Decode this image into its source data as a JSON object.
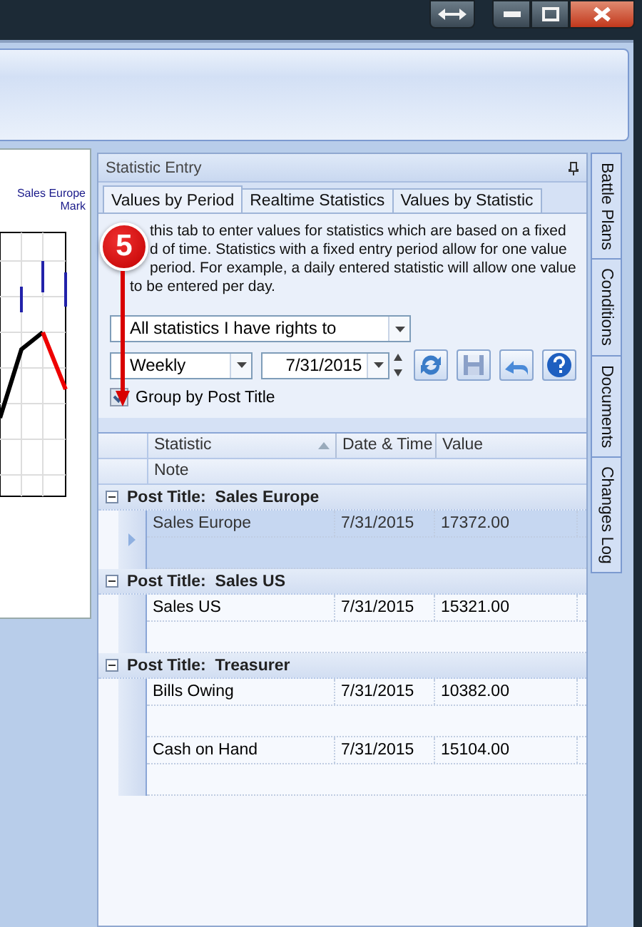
{
  "chart": {
    "legend": [
      "Sales Europe",
      "Mark"
    ]
  },
  "panel": {
    "title": "Statistic Entry",
    "tabs": [
      {
        "label": "Values by Period",
        "selected": true
      },
      {
        "label": "Realtime Statistics",
        "selected": false
      },
      {
        "label": "Values by Statistic",
        "selected": false
      }
    ],
    "description_lines": [
      "this tab to enter values for statistics which are based on a fixed",
      "d of time. Statistics with a fixed entry period allow for one value",
      "period. For example, a daily entered statistic will allow one value",
      "to be entered per day."
    ],
    "statistics_filter": "All statistics I have rights to",
    "period": "Weekly",
    "date": "7/31/2015",
    "group_by": {
      "label": "Group by Post Title",
      "checked": true
    },
    "grid": {
      "columns": [
        "Statistic",
        "Date & Time",
        "Value"
      ],
      "note_column": "Note",
      "groups": [
        {
          "title": "Post Title:  Sales Europe",
          "expanded": true,
          "rows": [
            {
              "statistic": "Sales Europe",
              "date": "7/31/2015",
              "value": "17372.00",
              "selected": true
            }
          ]
        },
        {
          "title": "Post Title:  Sales US",
          "expanded": true,
          "rows": [
            {
              "statistic": "Sales US",
              "date": "7/31/2015",
              "value": "15321.00",
              "selected": false
            }
          ]
        },
        {
          "title": "Post Title:  Treasurer",
          "expanded": true,
          "rows": [
            {
              "statistic": "Bills Owing",
              "date": "7/31/2015",
              "value": "10382.00",
              "selected": false
            },
            {
              "statistic": "Cash on Hand",
              "date": "7/31/2015",
              "value": "15104.00",
              "selected": false
            }
          ]
        }
      ]
    }
  },
  "side_tabs": [
    "Battle Plans",
    "Conditions",
    "Documents",
    "Changes Log"
  ],
  "callout": {
    "number": "5"
  }
}
